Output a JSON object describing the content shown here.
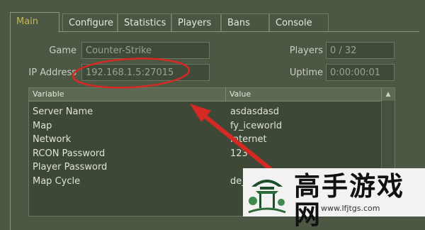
{
  "tabs": [
    {
      "label": "Main",
      "active": true
    },
    {
      "label": "Configure"
    },
    {
      "label": "Statistics"
    },
    {
      "label": "Players"
    },
    {
      "label": "Bans"
    },
    {
      "label": "Console"
    }
  ],
  "info": {
    "game_label": "Game",
    "game_value": "Counter-Strike",
    "ip_label": "IP Address",
    "ip_value": "192.168.1.5:27015",
    "players_label": "Players",
    "players_value": "0 / 32",
    "uptime_label": "Uptime",
    "uptime_value": "0:00:00:01"
  },
  "table": {
    "col_variable": "Variable",
    "col_value": "Value",
    "rows": [
      {
        "variable": "Server Name",
        "value": "asdasdasd"
      },
      {
        "variable": "Map",
        "value": "fy_iceworld"
      },
      {
        "variable": "Network",
        "value": "Internet"
      },
      {
        "variable": "RCON Password",
        "value": "123"
      },
      {
        "variable": "Player Password",
        "value": ""
      },
      {
        "variable": "Map Cycle",
        "value": "de_"
      }
    ]
  },
  "colors": {
    "background": "#4c5844",
    "active_tab_text": "#c4b55a",
    "annotation": "#d42a23"
  },
  "watermark": {
    "title": "高手游戏网",
    "url": "www.lfjtgs.com"
  }
}
